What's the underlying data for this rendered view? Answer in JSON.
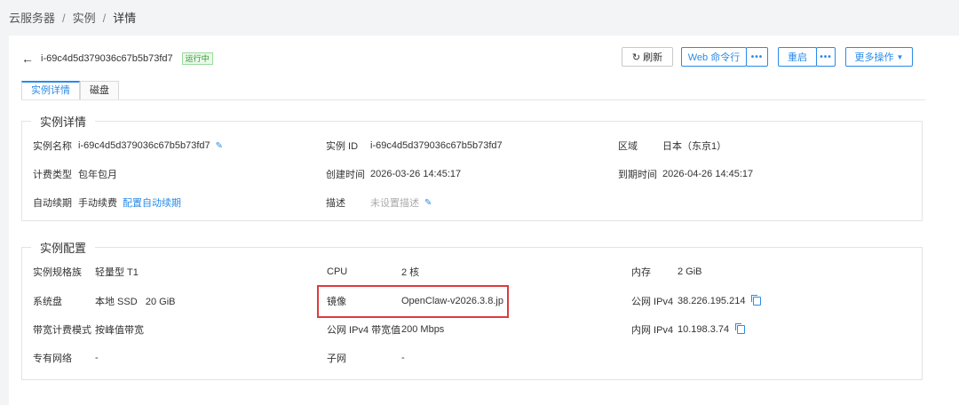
{
  "breadcrumb": {
    "items": [
      "云服务器",
      "实例",
      "详情"
    ],
    "sep": "/"
  },
  "header": {
    "instance_id": "i-69c4d5d379036c67b5b73fd7",
    "status": "运行中",
    "buttons": {
      "refresh": "刷新",
      "web_shell": "Web 命令行",
      "more_small": "•••",
      "restart": "重启",
      "more_small2": "•••",
      "more_ops": "更多操作"
    },
    "icons": {
      "back": "arrow-left-icon",
      "refresh": "refresh-icon",
      "more": "chevron-down-icon"
    }
  },
  "tabs": [
    "实例详情",
    "磁盘"
  ],
  "details": {
    "title": "实例详情",
    "name_label": "实例名称",
    "name_value": "i-69c4d5d379036c67b5b73fd7",
    "id_label": "实例 ID",
    "id_value": "i-69c4d5d379036c67b5b73fd7",
    "region_label": "区域",
    "region_value": "日本（东京1）",
    "billing_label": "计费类型",
    "billing_value": "包年包月",
    "created_label": "创建时间",
    "created_value": "2026-03-26 14:45:17",
    "expire_label": "到期时间",
    "expire_value": "2026-04-26 14:45:17",
    "renew_label": "自动续期",
    "renew_value": "手动续费",
    "renew_link": "配置自动续期",
    "desc_label": "描述",
    "desc_value": "未设置描述"
  },
  "config": {
    "title": "实例配置",
    "family_label": "实例规格族",
    "family_value": "轻量型 T1",
    "cpu_label": "CPU",
    "cpu_value": "2 核",
    "mem_label": "内存",
    "mem_value": "2 GiB",
    "disk_label": "系统盘",
    "disk_value": "本地 SSD   20 GiB",
    "image_label": "镜像",
    "image_value": "OpenClaw-v2026.3.8.jp",
    "ipv4_label": "公网 IPv4",
    "ipv4_value": "38.226.195.214",
    "bw_mode_label": "带宽计费模式",
    "bw_mode_value": "按峰值带宽",
    "bw_label": "公网 IPv4 带宽值",
    "bw_value": "200 Mbps",
    "lan_label": "内网 IPv4",
    "lan_value": "10.198.3.74",
    "vpc_label": "专有网络",
    "vpc_value": "-",
    "subnet_label": "子网",
    "subnet_value": "-"
  },
  "colors": {
    "accent": "#2a8be8",
    "status": "#2a9d2a",
    "highlight": "#e0393e"
  }
}
